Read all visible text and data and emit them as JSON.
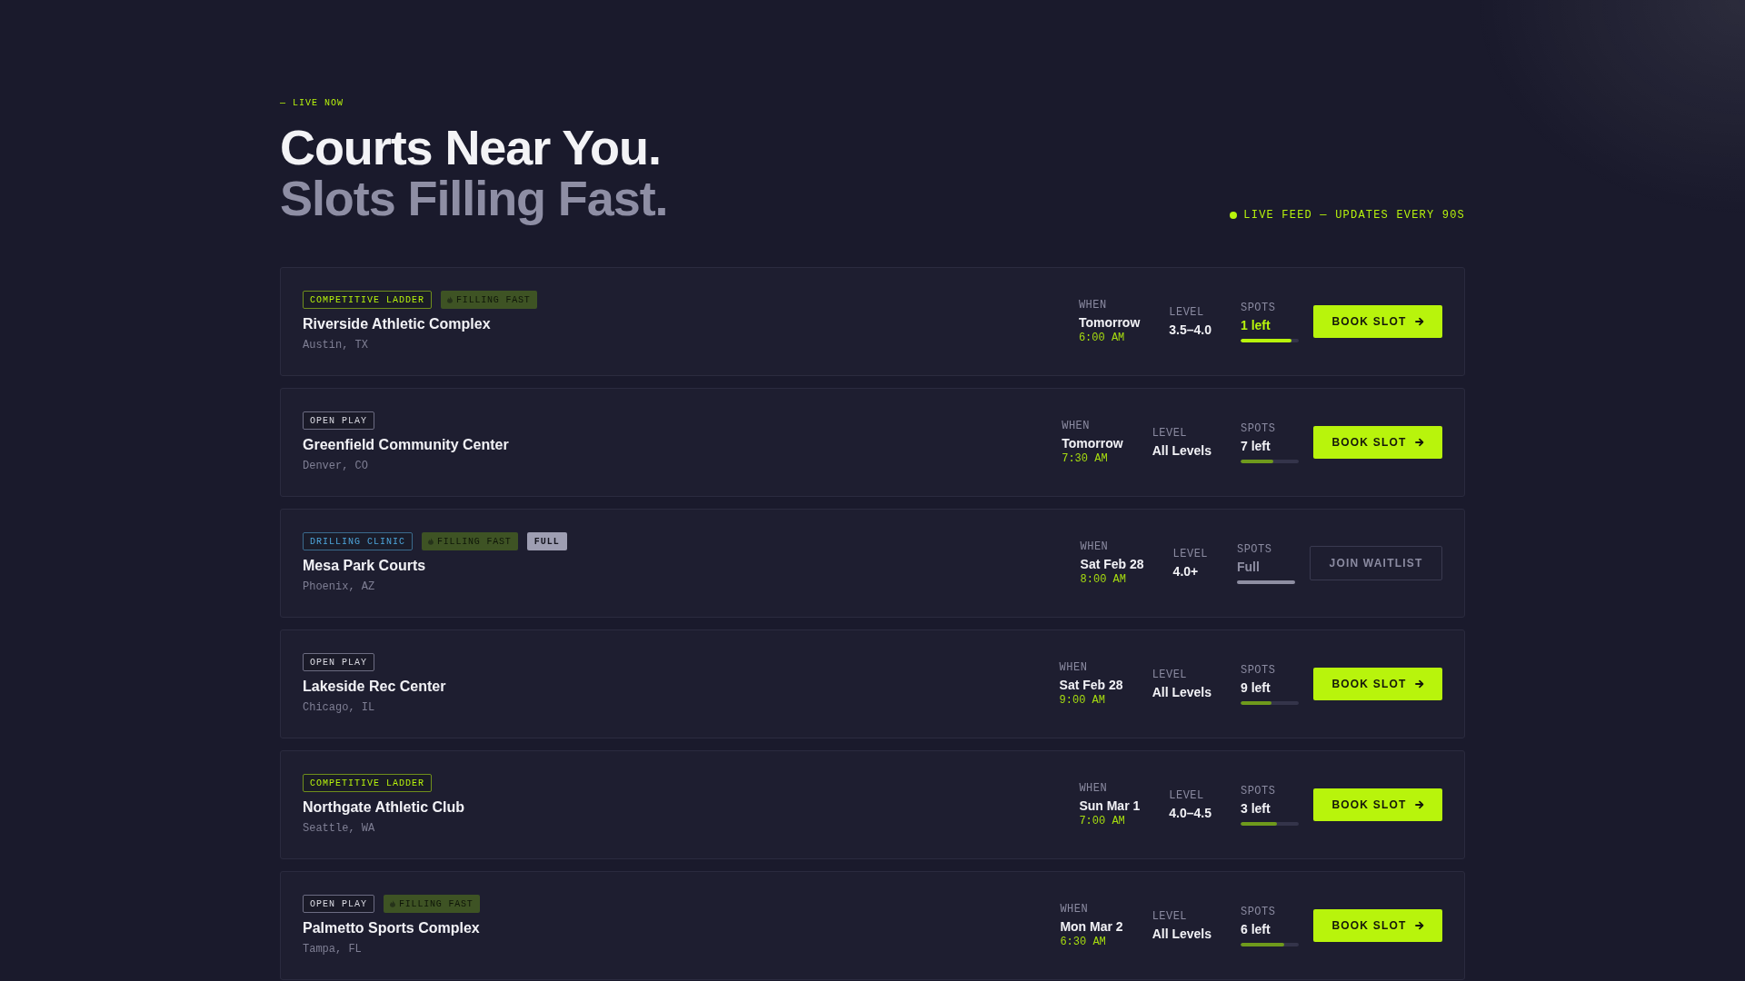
{
  "header": {
    "eyebrow": "— LIVE NOW",
    "title": "Courts Near You.",
    "subtitle": "Slots Filling Fast.",
    "live_feed": "LIVE FEED — UPDATES EVERY 90S"
  },
  "courts": [
    {
      "tags": [
        {
          "label": "COMPETITIVE LADDER",
          "kind": "ladder"
        },
        {
          "label": "FILLING FAST",
          "kind": "hot"
        }
      ],
      "name": "Riverside Athletic Complex",
      "location": "Austin, TX",
      "when": {
        "label": "WHEN",
        "day": "Tomorrow",
        "time": "6:00 AM"
      },
      "skill": {
        "label": "LEVEL",
        "value": "3.5–4.0"
      },
      "spots": {
        "label": "SPOTS",
        "value": "1 left",
        "kind": "low",
        "level": 0.88
      },
      "action": {
        "label": "BOOK SLOT",
        "kind": "book"
      }
    },
    {
      "tags": [
        {
          "label": "OPEN PLAY",
          "kind": "open"
        }
      ],
      "name": "Greenfield Community Center",
      "location": "Denver, CO",
      "when": {
        "label": "WHEN",
        "day": "Tomorrow",
        "time": "7:30 AM"
      },
      "skill": {
        "label": "LEVEL",
        "value": "All Levels"
      },
      "spots": {
        "label": "SPOTS",
        "value": "7 left",
        "kind": "open",
        "level": 0.57
      },
      "action": {
        "label": "BOOK SLOT",
        "kind": "book"
      }
    },
    {
      "tags": [
        {
          "label": "DRILLING CLINIC",
          "kind": "clinic"
        },
        {
          "label": "FILLING FAST",
          "kind": "hot"
        },
        {
          "label": "FULL",
          "kind": "full"
        }
      ],
      "name": "Mesa Park Courts",
      "location": "Phoenix, AZ",
      "when": {
        "label": "WHEN",
        "day": "Sat Feb 28",
        "time": "8:00 AM"
      },
      "skill": {
        "label": "LEVEL",
        "value": "4.0+"
      },
      "spots": {
        "label": "SPOTS",
        "value": "Full",
        "kind": "full"
      },
      "action": {
        "label": "JOIN WAITLIST",
        "kind": "waitlist"
      }
    },
    {
      "tags": [
        {
          "label": "OPEN PLAY",
          "kind": "open"
        }
      ],
      "name": "Lakeside Rec Center",
      "location": "Chicago, IL",
      "when": {
        "label": "WHEN",
        "day": "Sat Feb 28",
        "time": "9:00 AM"
      },
      "skill": {
        "label": "LEVEL",
        "value": "All Levels"
      },
      "spots": {
        "label": "SPOTS",
        "value": "9 left",
        "kind": "open",
        "level": 0.53
      },
      "action": {
        "label": "BOOK SLOT",
        "kind": "book"
      }
    },
    {
      "tags": [
        {
          "label": "COMPETITIVE LADDER",
          "kind": "ladder"
        }
      ],
      "name": "Northgate Athletic Club",
      "location": "Seattle, WA",
      "when": {
        "label": "WHEN",
        "day": "Sun Mar 1",
        "time": "7:00 AM"
      },
      "skill": {
        "label": "LEVEL",
        "value": "4.0–4.5"
      },
      "spots": {
        "label": "SPOTS",
        "value": "3 left",
        "kind": "open",
        "level": 0.63
      },
      "action": {
        "label": "BOOK SLOT",
        "kind": "book"
      }
    },
    {
      "tags": [
        {
          "label": "OPEN PLAY",
          "kind": "open"
        },
        {
          "label": "FILLING FAST",
          "kind": "hot"
        }
      ],
      "name": "Palmetto Sports Complex",
      "location": "Tampa, FL",
      "when": {
        "label": "WHEN",
        "day": "Mon Mar 2",
        "time": "6:30 AM"
      },
      "skill": {
        "label": "LEVEL",
        "value": "All Levels"
      },
      "spots": {
        "label": "SPOTS",
        "value": "6 left",
        "kind": "open",
        "level": 0.75
      },
      "action": {
        "label": "BOOK SLOT",
        "kind": "book"
      }
    }
  ]
}
